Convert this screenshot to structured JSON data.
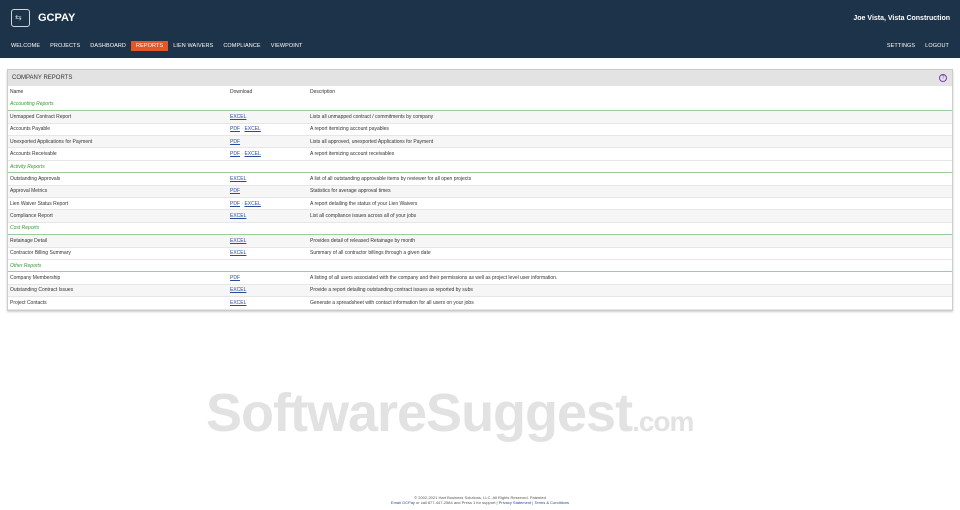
{
  "header": {
    "brand": "GCPAY",
    "user": "Joe Vista, Vista Construction"
  },
  "nav": [
    "WELCOME",
    "PROJECTS",
    "DASHBOARD",
    "REPORTS",
    "LIEN WAIVERS",
    "COMPLIANCE",
    "VIEWPOINT"
  ],
  "nav_active": "REPORTS",
  "right_nav": [
    "SETTINGS",
    "LOGOUT"
  ],
  "panel": {
    "title": "COMPANY REPORTS",
    "help": "?"
  },
  "columns": [
    "Name",
    "Download",
    "Description"
  ],
  "sections": [
    {
      "title": "Accounting Reports",
      "rows": [
        {
          "name": "Unmapped Contract Report",
          "links": [
            "EXCEL"
          ],
          "desc": "Lists all unmapped contract / commitments by company"
        },
        {
          "name": "Accounts Payable",
          "links": [
            "PDF",
            "EXCEL"
          ],
          "desc": "A report itemizing account payables"
        },
        {
          "name": "Unexported Applications for Payment",
          "links": [
            "PDF"
          ],
          "desc": "Lists all approved, unexported Applications for Payment"
        },
        {
          "name": "Accounts Receivable",
          "links": [
            "PDF",
            "EXCEL"
          ],
          "desc": "A report itemizing account receivables"
        }
      ]
    },
    {
      "title": "Activity Reports",
      "rows": [
        {
          "name": "Outstanding Approvals",
          "links": [
            "EXCEL"
          ],
          "desc": "A list of all outstanding approvable items by reviewer for all open projects"
        },
        {
          "name": "Approval Metrics",
          "links": [
            "PDF"
          ],
          "desc": "Statistics for average approval times"
        },
        {
          "name": "Lien Waiver Status Report",
          "links": [
            "PDF",
            "EXCEL"
          ],
          "desc": "A report detailing the status of your Lien Waivers"
        },
        {
          "name": "Compliance Report",
          "links": [
            "EXCEL"
          ],
          "desc": "List all compliance issues across all of your jobs"
        }
      ]
    },
    {
      "title": "Cost Reports",
      "rows": [
        {
          "name": "Retainage Detail",
          "links": [
            "EXCEL"
          ],
          "desc": "Provides detail of released Retainage by month"
        },
        {
          "name": "Contractor Billing Summary",
          "links": [
            "EXCEL"
          ],
          "desc": "Summary of all contractor billings through a given date"
        }
      ]
    },
    {
      "title": "Other Reports",
      "rows": [
        {
          "name": "Company Membership",
          "links": [
            "PDF"
          ],
          "desc": "A listing of all users associated with the company and their permissions as well as project level user information."
        },
        {
          "name": "Outstanding Contract Issues",
          "links": [
            "EXCEL"
          ],
          "desc": "Provide a report detailing outstanding contract issues as reported by subs"
        },
        {
          "name": "Project Contacts",
          "links": [
            "EXCEL"
          ],
          "desc": "Generate a spreadsheet with contact information for all users on your jobs"
        }
      ]
    }
  ],
  "watermark": {
    "main": "SoftwareSuggest",
    "suffix": ".com"
  },
  "footer": {
    "copyright": "© 2002-2021 Hart Business Solutions, LLC. All Rights Reserved. Patented",
    "email": "Email GCPay",
    "support": " or call 877-447-2584 and Press 1 for support | ",
    "privacy": "Privacy Statement",
    "sep": " | ",
    "terms": "Terms & Conditions"
  }
}
